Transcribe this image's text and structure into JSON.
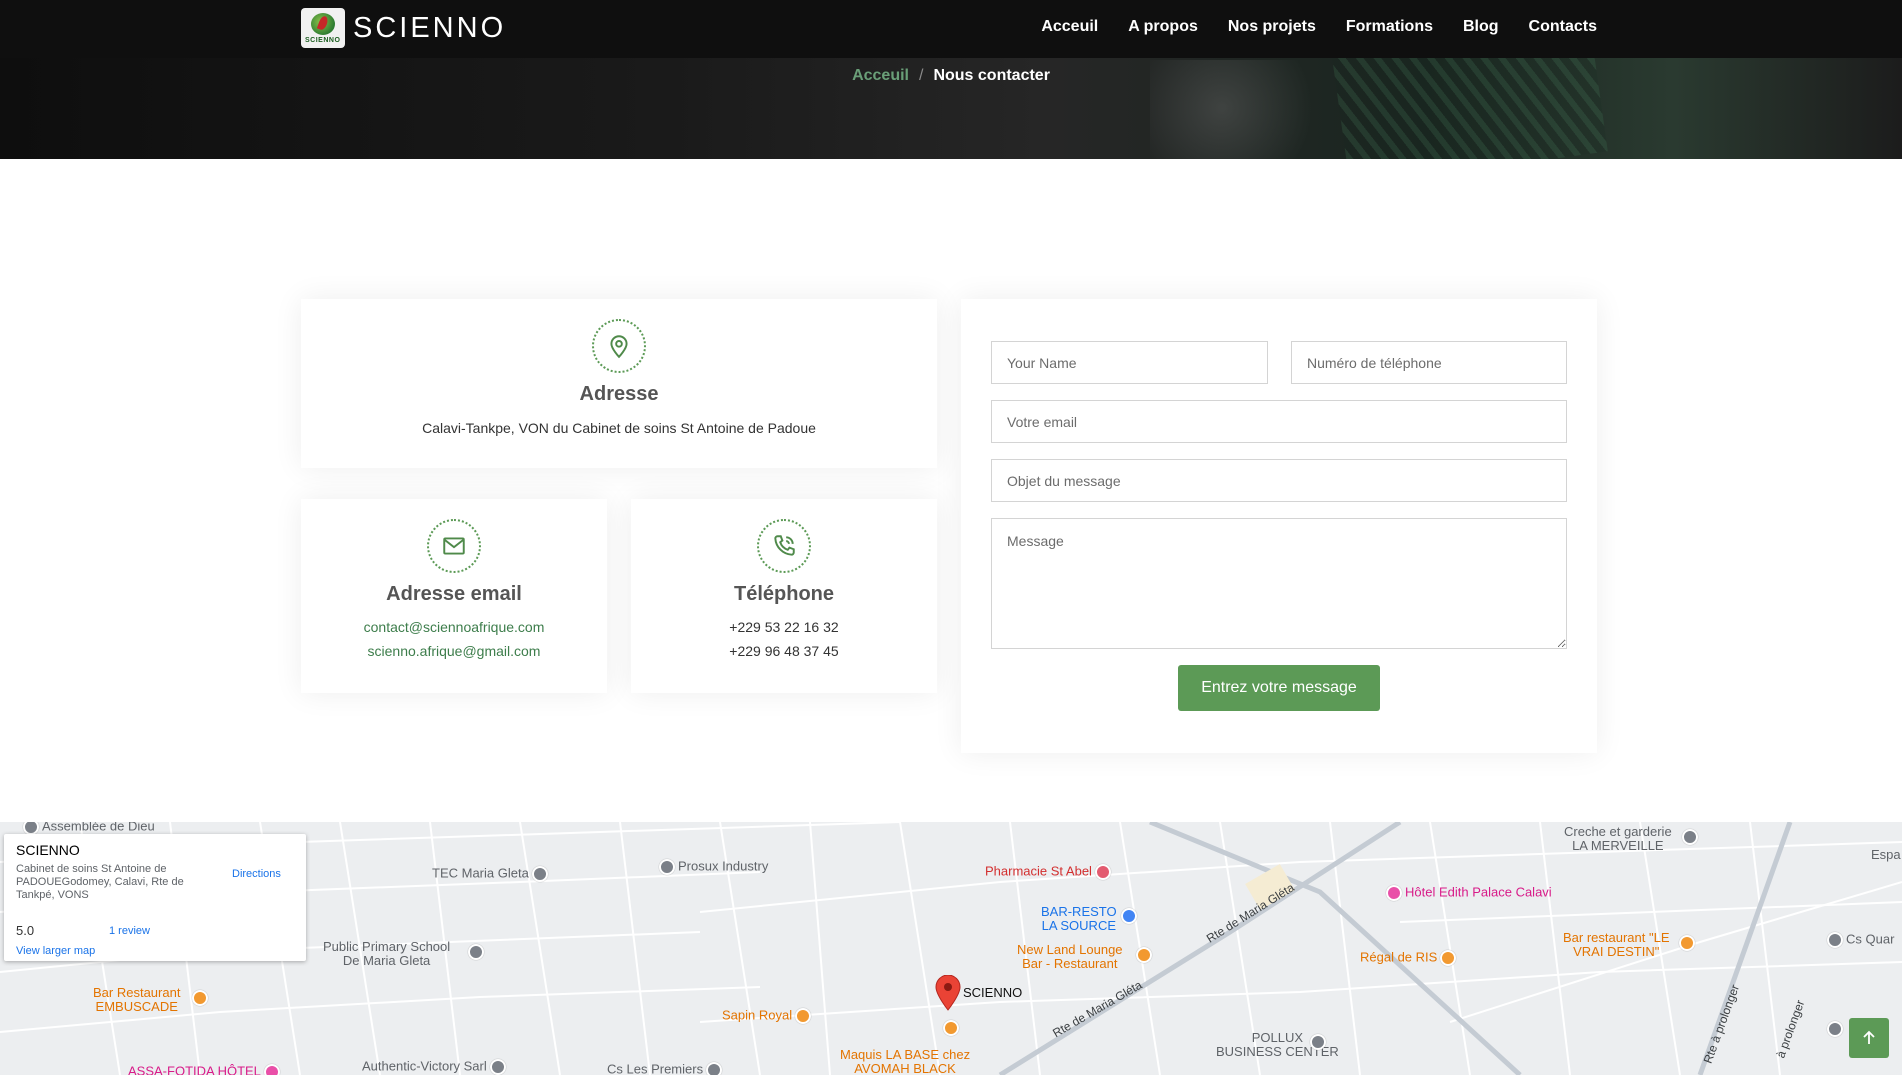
{
  "header": {
    "brand": "SCIENNO",
    "logo_text": "SCIENNO",
    "nav": [
      "Acceuil",
      "A propos",
      "Nos projets",
      "Formations",
      "Blog",
      "Contacts"
    ]
  },
  "breadcrumb": {
    "home": "Acceuil",
    "separator": "/",
    "current": "Nous contacter"
  },
  "cards": {
    "address": {
      "title": "Adresse",
      "text": "Calavi-Tankpe, VON du Cabinet de soins St Antoine de Padoue"
    },
    "email": {
      "title": "Adresse email",
      "lines": [
        "contact@sciennoafrique.com",
        "scienno.afrique@gmail.com"
      ]
    },
    "phone": {
      "title": "Téléphone",
      "lines": [
        "+229 53 22 16 32",
        "+229 96 48 37 45"
      ]
    }
  },
  "form": {
    "name_placeholder": "Your Name",
    "phone_placeholder": "Numéro de téléphone",
    "email_placeholder": "Votre email",
    "subject_placeholder": "Objet du message",
    "message_placeholder": "Message",
    "submit_label": "Entrez votre message"
  },
  "map": {
    "infobox": {
      "title": "SCIENNO",
      "address": "Cabinet de soins St Antoine de PADOUEGodomey, Calavi, Rte de Tankpé, VONS",
      "directions": "Directions",
      "rating": "5.0",
      "reviews": "1 review",
      "larger_map": "View larger map"
    },
    "marker_label": "SCIENNO",
    "places": {
      "assemblee": "Assemblée de Dieu",
      "tec": "TEC Maria Gleta",
      "prosux": "Prosux Industry",
      "pharmacie": "Pharmacie St Abel",
      "bar_resto_1": "BAR-RESTO",
      "bar_resto_2": "LA SOURCE",
      "new_land_1": "New Land Lounge",
      "new_land_2": "Bar - Restaurant",
      "primary_1": "Public Primary School",
      "primary_2": "De Maria Gleta",
      "embuscade_1": "Bar Restaurant",
      "embuscade_2": "EMBUSCADE",
      "sapin": "Sapin Royal",
      "maquis_1": "Maquis LA BASE chez",
      "maquis_2": "AVOMAH BLACK",
      "creche_1": "Creche et garderie",
      "creche_2": "LA MERVEILLE",
      "hotel_edith": "Hôtel Edith Palace Calavi",
      "regal": "Régal de RIS",
      "vrai_destin_1": "Bar restaurant \"LE",
      "vrai_destin_2": "VRAI DESTIN\"",
      "pollux_1": "POLLUX",
      "pollux_2": "BUSINESS CENTER",
      "authentic": "Authentic-Victory Sarl",
      "cs_premiers": "Cs Les Premiers",
      "assa": "ASSA-FOTIDA HÔTEL",
      "cs_quar": "Cs Quar",
      "espa": "Espa"
    },
    "roads": {
      "maria_gleta_1": "Rte de Maria Gléta",
      "maria_gleta_2": "Rte de Maria Gléta",
      "prolonger_1": "Rte à prolonger",
      "prolonger_2": "à prolonger"
    }
  },
  "colors": {
    "accent": "#5c9a56",
    "link": "#3d7d4b",
    "header_bg": "#0f0f0f"
  }
}
